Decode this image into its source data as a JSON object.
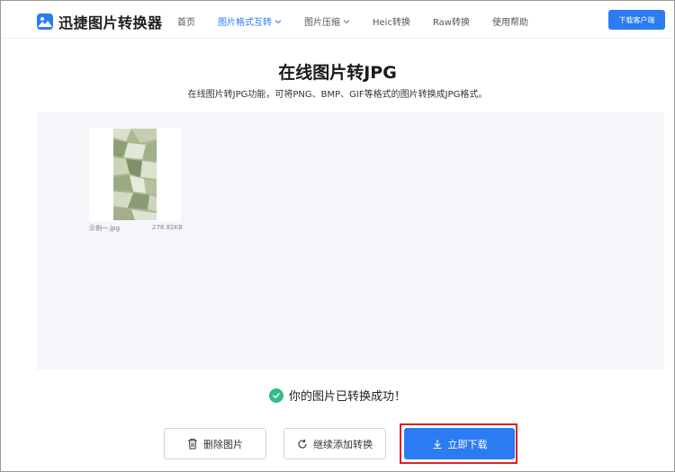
{
  "header": {
    "logo_text": "迅捷图片转换器",
    "nav": [
      {
        "label": "首页"
      },
      {
        "label": "图片格式互转"
      },
      {
        "label": "图片压缩"
      },
      {
        "label": "Heic转换"
      },
      {
        "label": "Raw转换"
      },
      {
        "label": "使用帮助"
      }
    ],
    "download_client_label": "下载客户端"
  },
  "main": {
    "title": "在线图片转JPG",
    "subtitle": "在线图片转JPG功能，可将PNG、BMP、GIF等格式的图片转换成JPG格式。"
  },
  "file": {
    "name": "示例一.jpg",
    "size": "278.82KB"
  },
  "status": {
    "success_text": "你的图片已转换成功！"
  },
  "actions": {
    "delete_label": "删除图片",
    "continue_label": "继续添加转换",
    "download_label": "立即下载"
  },
  "colors": {
    "brand": "#2b7bf2",
    "success": "#2ebd85",
    "workarea_bg": "#f4f6f9",
    "highlight": "#e02020"
  }
}
